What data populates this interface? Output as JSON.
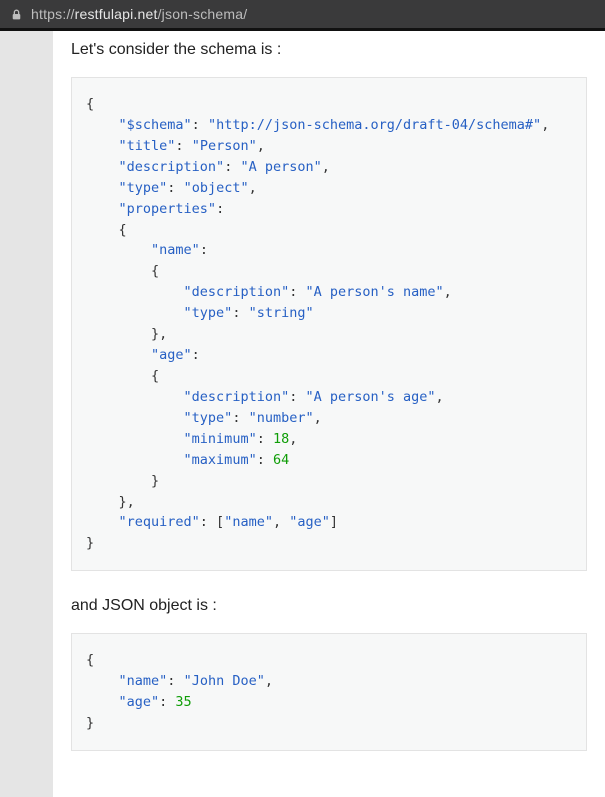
{
  "browser": {
    "url_prefix": "https://",
    "url_domain": "restfulapi.net",
    "url_path": "/json-schema/"
  },
  "text": {
    "schema_intro": "Let's consider the schema is :",
    "json_intro": "and JSON object is :"
  },
  "schema_code": {
    "l1": "{",
    "l2k": "\"$schema\"",
    "l2v": "\"http://json-schema.org/draft-04/schema#\"",
    "l3k": "\"title\"",
    "l3v": "\"Person\"",
    "l4k": "\"description\"",
    "l4v": "\"A person\"",
    "l5k": "\"type\"",
    "l5v": "\"object\"",
    "l6k": "\"properties\"",
    "l7": "{",
    "l8k": "\"name\"",
    "l9": "{",
    "l10k": "\"description\"",
    "l10v": "\"A person's name\"",
    "l11k": "\"type\"",
    "l11v": "\"string\"",
    "l12": "},",
    "l13k": "\"age\"",
    "l14": "{",
    "l15k": "\"description\"",
    "l15v": "\"A person's age\"",
    "l16k": "\"type\"",
    "l16v": "\"number\"",
    "l17k": "\"minimum\"",
    "l17v": "18",
    "l18k": "\"maximum\"",
    "l18v": "64",
    "l19": "}",
    "l20": "},",
    "l21k": "\"required\"",
    "l21v1": "\"name\"",
    "l21v2": "\"age\"",
    "l22": "}"
  },
  "json_code": {
    "l1": "{",
    "l2k": "\"name\"",
    "l2v": "\"John Doe\"",
    "l3k": "\"age\"",
    "l3v": "35",
    "l4": "}"
  }
}
